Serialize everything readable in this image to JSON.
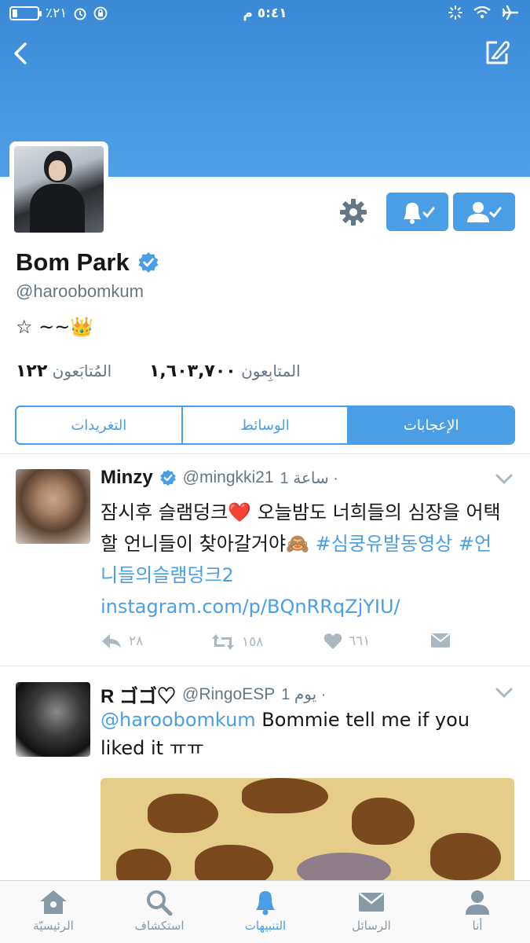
{
  "status_bar": {
    "battery_percent": "٪٢١",
    "battery_level": 0.21,
    "time": "٥:٤١ م"
  },
  "header": {
    "back_icon": "chevron-left-icon",
    "compose_icon": "compose-icon"
  },
  "profile": {
    "name": "Bom Park",
    "handle": "@haroobomkum",
    "bio": "☆ ~~👑",
    "following_count": "١٢٢",
    "following_label": "المُتابَعون",
    "followers_count": "١,٦٠٣,٧٠٠",
    "followers_label": "المتابِعون"
  },
  "tabs": {
    "tweets": "التغريدات",
    "media": "الوسائط",
    "likes": "الإعجابات"
  },
  "tweets": [
    {
      "name": "Minzy",
      "handle": "@mingkki21",
      "time": "1 ساعة ·",
      "text_plain": "잠시후 슬램덩크❤️  오늘밤도 너희들의 심장을 어택할 언니들이 찾아갈거야🙈 ",
      "text_link": "#심쿵유발동영상 #언니들의슬램덩크2 instagram.com/p/BQnRRqZjYIU/",
      "replies": "٢٨",
      "retweets": "١٥٨",
      "likes": "٦٦١"
    },
    {
      "name": "R ゴゴ♡",
      "handle": "@RingoESP",
      "time": "1 يوم ·",
      "mention": "@haroobomkum",
      "text_plain": " Bommie tell me if you liked it ㅠㅠ"
    }
  ],
  "tabbar": {
    "home": "الرئيسيّة",
    "explore": "استكشاف",
    "notifications": "التنبيهات",
    "messages": "الرسائل",
    "me": "أنا"
  },
  "colors": {
    "accent": "#4a9ee6",
    "header": "#3a89d6",
    "muted": "#657786"
  }
}
